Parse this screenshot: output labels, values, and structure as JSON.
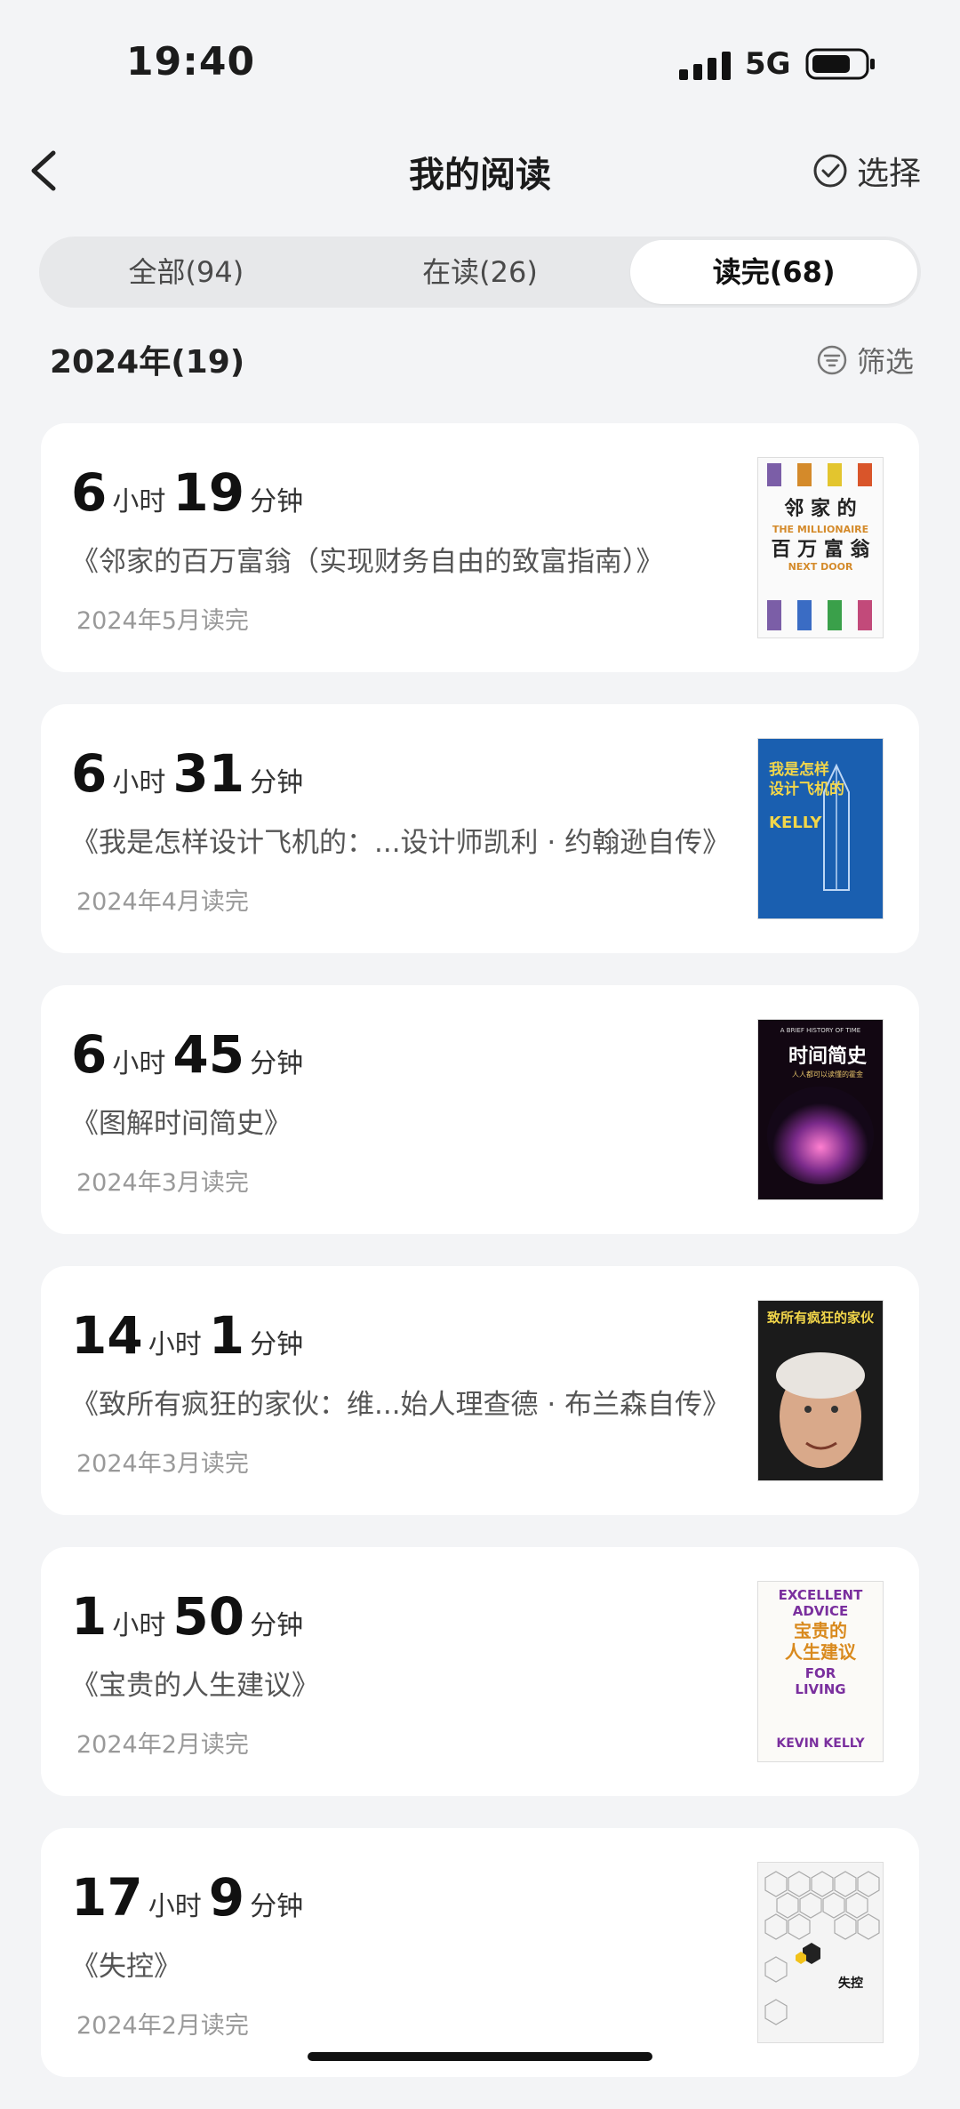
{
  "status_bar": {
    "time": "19:40",
    "network": "5G"
  },
  "header": {
    "title": "我的阅读",
    "select_label": "选择"
  },
  "tabs": [
    {
      "label": "全部(94)",
      "active": false
    },
    {
      "label": "在读(26)",
      "active": false
    },
    {
      "label": "读完(68)",
      "active": true
    }
  ],
  "section": {
    "title": "2024年(19)",
    "filter_label": "筛选"
  },
  "books": [
    {
      "hours": "6",
      "minutes": "19",
      "hours_unit": "小时",
      "minutes_unit": "分钟",
      "title": "《邻家的百万富翁（实现财务自由的致富指南）》",
      "date": "2024年5月读完",
      "cover": {
        "line1": "邻 家 的",
        "line2": "THE MILLIONAIRE",
        "line3": "百 万 富 翁",
        "line4": "NEXT DOOR"
      }
    },
    {
      "hours": "6",
      "minutes": "31",
      "hours_unit": "小时",
      "minutes_unit": "分钟",
      "title": "《我是怎样设计飞机的：...设计师凯利 · 约翰逊自传》",
      "date": "2024年4月读完",
      "cover": {
        "line1": "我是怎样",
        "line2": "设计飞机的",
        "line3": "KELLY"
      }
    },
    {
      "hours": "6",
      "minutes": "45",
      "hours_unit": "小时",
      "minutes_unit": "分钟",
      "title": "《图解时间简史》",
      "date": "2024年3月读完",
      "cover": {
        "line1": "A BRIEF HISTORY OF TIME",
        "line2": "时间简史",
        "line3": "人人都可以读懂的霍金"
      }
    },
    {
      "hours": "14",
      "minutes": "1",
      "hours_unit": "小时",
      "minutes_unit": "分钟",
      "title": "《致所有疯狂的家伙：维...始人理查德 · 布兰森自传》",
      "date": "2024年3月读完",
      "cover": {
        "line1": "致所有疯狂的家伙"
      }
    },
    {
      "hours": "1",
      "minutes": "50",
      "hours_unit": "小时",
      "minutes_unit": "分钟",
      "title": "《宝贵的人生建议》",
      "date": "2024年2月读完",
      "cover": {
        "line1": "EXCELLENT",
        "line2": "ADVICE",
        "line3": "宝贵的",
        "line4": "人生建议",
        "line5": "FOR",
        "line6": "LIVING",
        "line7": "KEVIN KELLY"
      }
    },
    {
      "hours": "17",
      "minutes": "9",
      "hours_unit": "小时",
      "minutes_unit": "分钟",
      "title": "《失控》",
      "date": "2024年2月读完",
      "cover": {
        "line1": "失控"
      }
    }
  ]
}
